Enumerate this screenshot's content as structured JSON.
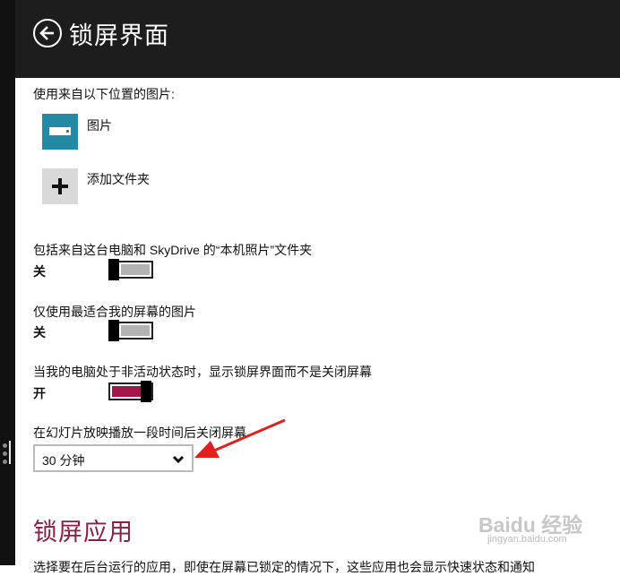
{
  "header": {
    "title": "锁屏界面"
  },
  "pictures_section": {
    "label": "使用来自以下位置的图片:",
    "items": [
      {
        "label": "图片",
        "icon": "pictures-library-icon",
        "color": "#2389a5"
      },
      {
        "label": "添加文件夹",
        "icon": "plus-icon",
        "color": "#d9d9d9"
      }
    ]
  },
  "settings": [
    {
      "label": "包括来自这台电脑和 SkyDrive 的“本机照片”文件夹",
      "state": "关",
      "on": false
    },
    {
      "label": "仅使用最适合我的屏幕的图片",
      "state": "关",
      "on": false
    },
    {
      "label": "当我的电脑处于非活动状态时，显示锁屏界面而不是关闭屏幕",
      "state": "开",
      "on": true
    }
  ],
  "screen_off": {
    "label": "在幻灯片放映播放一段时间后关闭屏幕",
    "selected": "30 分钟"
  },
  "lock_apps": {
    "title": "锁屏应用",
    "description": "选择要在后台运行的应用，即使在屏幕已锁定的情况下，这些应用也会显示快速状态和通知"
  },
  "watermark": {
    "logo": "Baidu 经验",
    "url": "jingyan.baidu.com"
  },
  "colors": {
    "header_bg": "#1d1d1d",
    "accent_on": "#a4174a",
    "section_title": "#8c1d45",
    "pictures_tile": "#2389a5",
    "arrow": "#e0201c"
  }
}
